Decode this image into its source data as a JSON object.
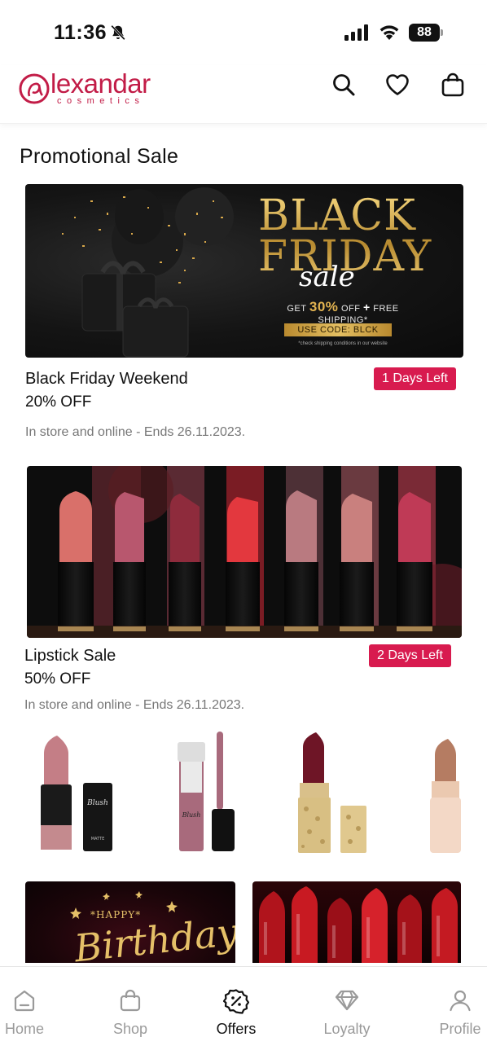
{
  "status_bar": {
    "time": "11:36",
    "battery": "88"
  },
  "header": {
    "logo_word": "lexandar",
    "logo_sub": "cosmetics",
    "icons": [
      "search-icon",
      "heart-icon",
      "bag-icon"
    ]
  },
  "section": {
    "title": "Promotional Sale"
  },
  "banner_black_friday": {
    "line1": "BLACK",
    "line2": "FRIDAY",
    "script": "sale",
    "offer_prefix": "GET",
    "offer_percent": "30%",
    "offer_off": "OFF",
    "offer_plus": "+",
    "offer_shipping": "FREE SHIPPING*",
    "code": "USE CODE: BLCK",
    "fine_print": "*check shipping conditions in our website"
  },
  "promotions": [
    {
      "name": "Black Friday Weekend",
      "discount": "20% OFF",
      "badge": "1 Days Left",
      "note": "In store and online - Ends 26.11.2023."
    },
    {
      "name": "Lipstick Sale",
      "discount": "50% OFF",
      "badge": "2 Days Left",
      "note": "In store and online - Ends 26.11.2023."
    }
  ],
  "bottom_cards": {
    "birthday_happy": "*HAPPY*",
    "birthday_word": "Birthday!"
  },
  "tabs": [
    {
      "label": "Home",
      "icon": "home-icon"
    },
    {
      "label": "Shop",
      "icon": "shop-bag-icon"
    },
    {
      "label": "Offers",
      "icon": "percent-badge-icon",
      "active": true
    },
    {
      "label": "Loyalty",
      "icon": "diamond-icon"
    },
    {
      "label": "Profile",
      "icon": "profile-icon"
    }
  ],
  "colors": {
    "brand": "#c21c47",
    "badge": "#d81b4f",
    "muted": "#777777"
  }
}
